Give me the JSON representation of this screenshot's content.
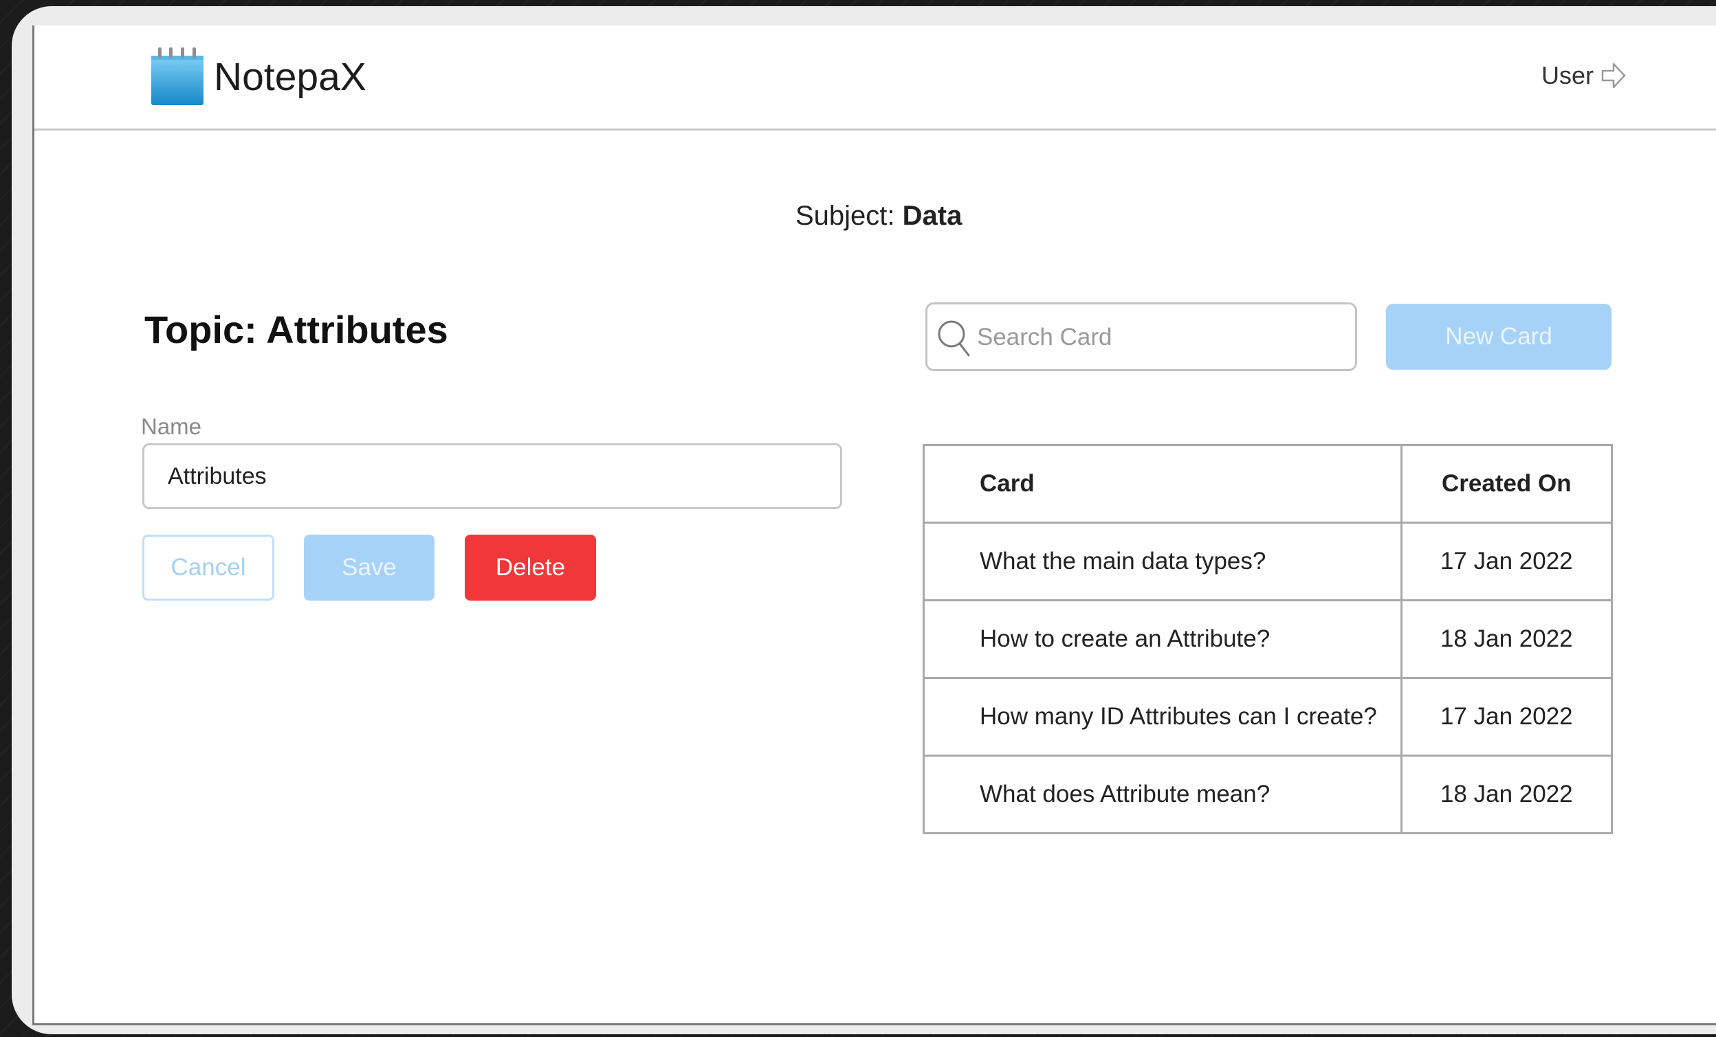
{
  "app": {
    "name": "NotepaX"
  },
  "header": {
    "user_label": "User"
  },
  "subject": {
    "label": "Subject: ",
    "value": "Data"
  },
  "topic": {
    "title": "Topic: Attributes"
  },
  "form": {
    "name_label": "Name",
    "name_value": "Attributes",
    "cancel_label": "Cancel",
    "save_label": "Save",
    "delete_label": "Delete"
  },
  "search": {
    "placeholder": "Search Card",
    "value": ""
  },
  "new_card": {
    "label": "New Card"
  },
  "table": {
    "headers": {
      "card": "Card",
      "created_on": "Created On"
    },
    "rows": [
      {
        "card": "What the main data types?",
        "created_on": "17 Jan 2022"
      },
      {
        "card": "How to create an Attribute?",
        "created_on": "18 Jan 2022"
      },
      {
        "card": "How many ID Attributes can I create?",
        "created_on": "17 Jan 2022"
      },
      {
        "card": "What does Attribute mean?",
        "created_on": "18 Jan 2022"
      }
    ]
  },
  "icons": {
    "logo": "notepad-icon",
    "user": "arrow-right-icon",
    "search": "search-icon"
  },
  "colors": {
    "primary_light": "#a7d2f7",
    "danger": "#f2373a",
    "border": "#c8c8c8",
    "logo_blue": "#2f9fd8"
  }
}
